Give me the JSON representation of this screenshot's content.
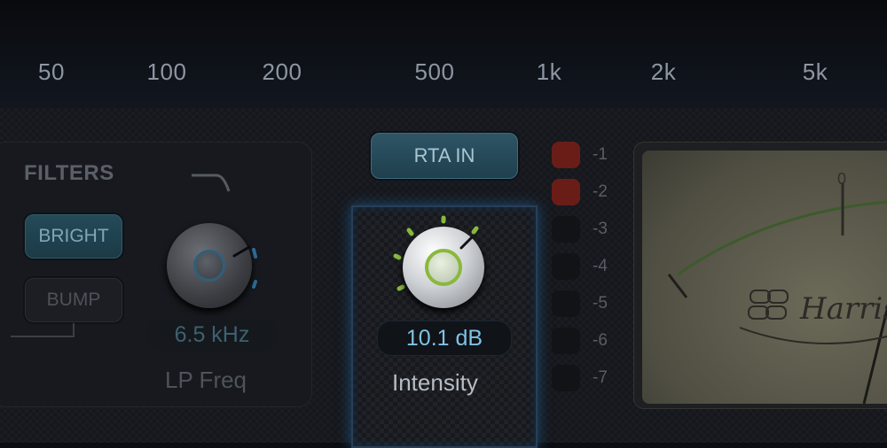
{
  "frequency_axis": {
    "labels": [
      "50",
      "100",
      "200",
      "500",
      "1k",
      "2k",
      "5k"
    ]
  },
  "filters": {
    "title": "FILTERS",
    "bright_label": "BRIGHT",
    "bump_label": "BUMP"
  },
  "lp_freq": {
    "value": "6.5 kHz",
    "label": "LP Freq"
  },
  "rta_button": {
    "label": "RTA IN"
  },
  "intensity": {
    "value": "10.1 dB",
    "label": "Intensity"
  },
  "level_meter": {
    "labels": [
      "-1",
      "-2",
      "-3",
      "-4",
      "-5",
      "-6",
      "-7"
    ]
  },
  "vu_meter": {
    "zero_label": "0"
  },
  "colors": {
    "accent_blue": "#7fc2e3",
    "accent_green": "#8ab83d",
    "led_red": "#6a1d17"
  }
}
